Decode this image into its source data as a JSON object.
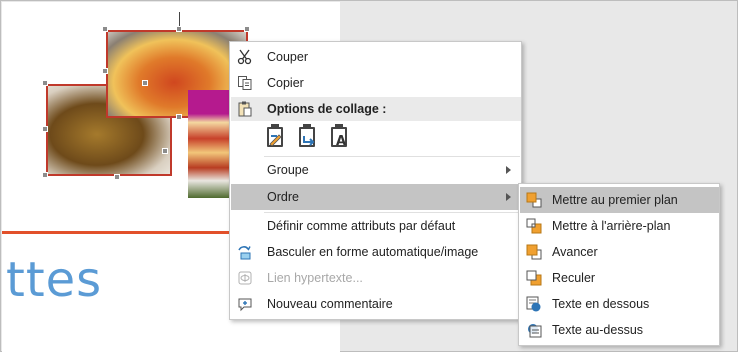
{
  "slide": {
    "title_fragment": "ttes"
  },
  "context_menu": {
    "items": [
      {
        "label": "Couper",
        "icon": "scissors-icon"
      },
      {
        "label": "Copier",
        "icon": "copy-icon"
      },
      {
        "label": "Options de collage :",
        "icon": "paste-icon"
      },
      {
        "label": "Groupe",
        "icon": ""
      },
      {
        "label": "Ordre",
        "icon": ""
      },
      {
        "label": "Définir comme attributs par défaut",
        "icon": ""
      },
      {
        "label": "Basculer en forme automatique/image",
        "icon": "shape-swap-icon"
      },
      {
        "label": "Lien hypertexte...",
        "icon": "hyperlink-icon"
      },
      {
        "label": "Nouveau commentaire",
        "icon": "comment-icon"
      }
    ],
    "paste_options": [
      "paste-keep-formatting-icon",
      "paste-picture-icon",
      "paste-text-only-icon"
    ],
    "highlight_color": "#c4c4c4"
  },
  "order_submenu": {
    "items": [
      {
        "label": "Mettre au premier plan",
        "icon": "bring-to-front-icon"
      },
      {
        "label": "Mettre à l'arrière-plan",
        "icon": "send-to-back-icon"
      },
      {
        "label": "Avancer",
        "icon": "bring-forward-icon"
      },
      {
        "label": "Reculer",
        "icon": "send-backward-icon"
      },
      {
        "label": "Texte en dessous",
        "icon": "text-below-icon"
      },
      {
        "label": "Texte au-dessus",
        "icon": "text-above-icon"
      }
    ]
  },
  "colors": {
    "title_blue": "#5b9bd5",
    "accent_line": "#e2502a",
    "icon_orange": "#f0a030",
    "icon_blue": "#2e75b6"
  }
}
